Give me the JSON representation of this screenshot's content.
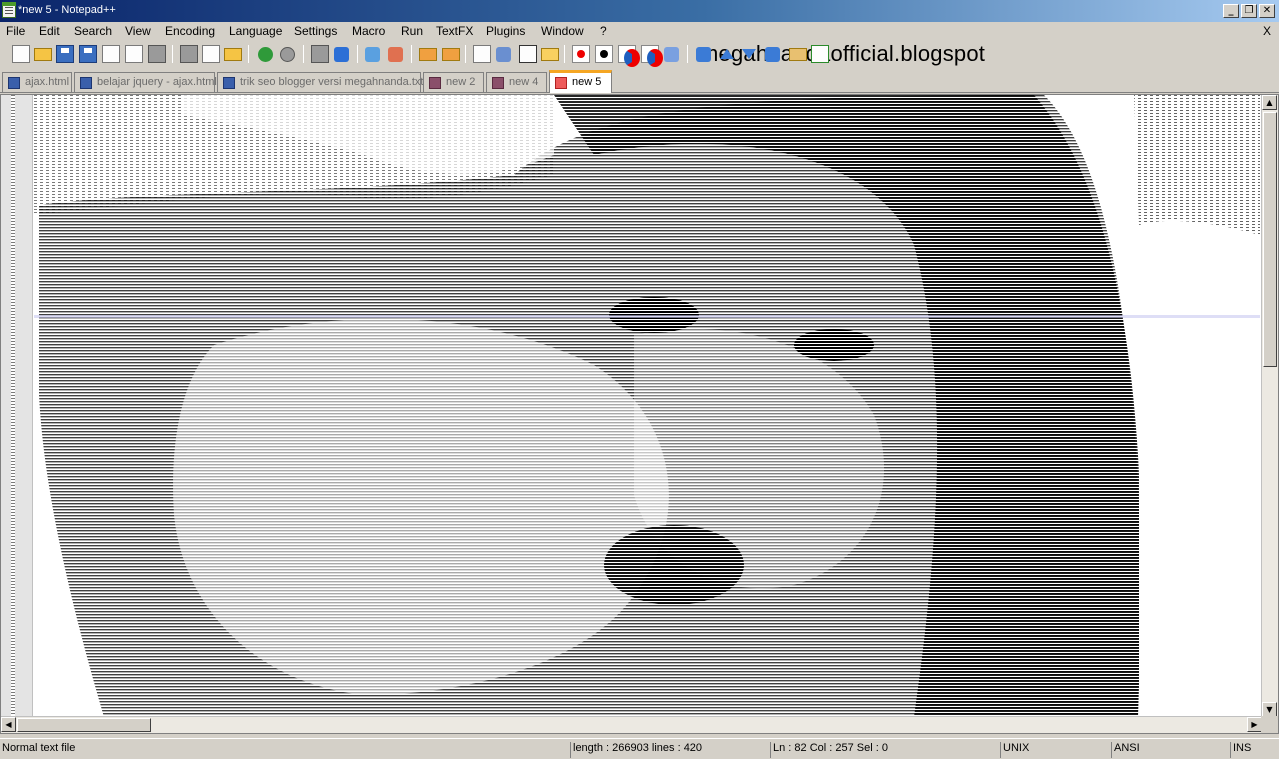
{
  "window": {
    "title": "*new 5 - Notepad++",
    "minimize": "_",
    "restore": "❐",
    "close": "✕"
  },
  "menu": {
    "items": [
      "File",
      "Edit",
      "Search",
      "View",
      "Encoding",
      "Language",
      "Settings",
      "Macro",
      "Run",
      "TextFX",
      "Plugins",
      "Window",
      "?"
    ],
    "close": "X"
  },
  "watermark": "megahnandaofficial.blogspot",
  "toolbar": {
    "buttons": [
      "new-file-icon",
      "open-folder-icon",
      "save-icon",
      "save-all-icon",
      "close-icon",
      "close-all-icon",
      "print-icon",
      "cut-icon",
      "copy-icon",
      "paste-icon",
      "undo-icon",
      "redo-icon",
      "find-icon",
      "replace-icon",
      "zoom-in-icon",
      "zoom-out-icon",
      "sync-vertical-icon",
      "sync-horizontal-icon",
      "word-wrap-icon",
      "show-all-chars-icon",
      "indent-guide-icon",
      "doc-map-icon",
      "record-macro-icon",
      "stop-macro-icon",
      "play-macro-icon",
      "run-macro-multiple-icon",
      "save-macro-icon",
      "textfx-icon",
      "up-icon",
      "down-icon",
      "sort-icon",
      "print-preview-icon",
      "spellcheck-icon"
    ]
  },
  "tabs": [
    {
      "label": "ajax.html",
      "modified": false,
      "active": false
    },
    {
      "label": "belajar jquery - ajax.html",
      "modified": false,
      "active": false
    },
    {
      "label": "trik seo blogger versi megahnanda.txt",
      "modified": false,
      "active": false
    },
    {
      "label": "new  2",
      "modified": true,
      "active": false
    },
    {
      "label": "new  4",
      "modified": true,
      "active": false
    },
    {
      "label": "new  5",
      "modified": true,
      "active": true
    }
  ],
  "scroll": {
    "up": "▲",
    "down": "▼",
    "left": "◀",
    "right": "▶"
  },
  "status": {
    "file_type": "Normal text file",
    "length_lines": "length : 266903    lines : 420",
    "position": "Ln : 82    Col : 257    Sel : 0",
    "eol": "UNIX",
    "encoding": "ANSI",
    "mode": "INS"
  },
  "colors": {
    "title_bar": "#0a246a",
    "active_tab_accent": "#f5a623",
    "chrome": "#d4d0c8"
  }
}
